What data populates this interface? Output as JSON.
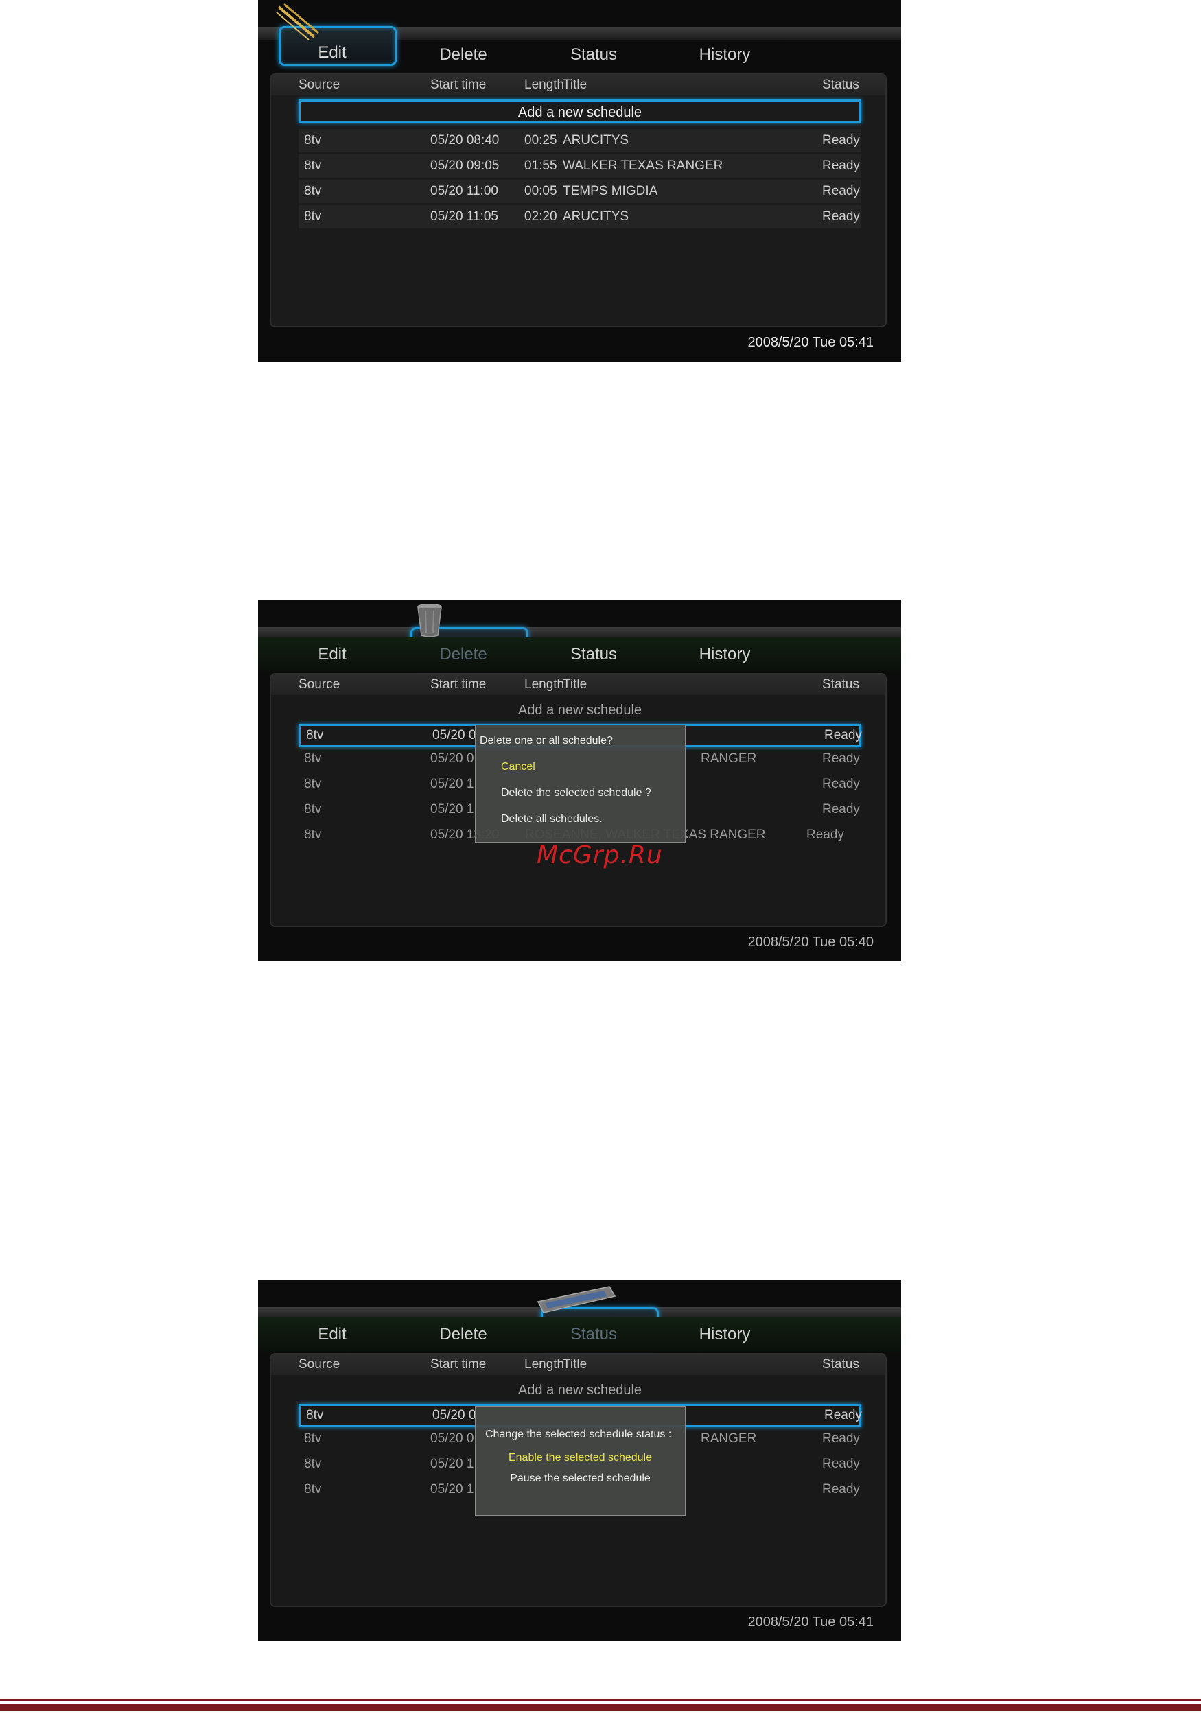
{
  "tabs": {
    "edit": "Edit",
    "delete": "Delete",
    "status": "Status",
    "history": "History"
  },
  "columns": {
    "source": "Source",
    "start": "Start time",
    "length": "Length",
    "title": "Title",
    "status": "Status"
  },
  "add_new": "Add a new schedule",
  "screen1": {
    "rows": [
      {
        "src": "8tv",
        "start": "05/20 08:40",
        "len": "00:25",
        "title": "ARUCITYS",
        "status": "Ready"
      },
      {
        "src": "8tv",
        "start": "05/20 09:05",
        "len": "01:55",
        "title": "WALKER TEXAS RANGER",
        "status": "Ready"
      },
      {
        "src": "8tv",
        "start": "05/20 11:00",
        "len": "00:05",
        "title": "TEMPS MIGDIA",
        "status": "Ready"
      },
      {
        "src": "8tv",
        "start": "05/20 11:05",
        "len": "02:20",
        "title": "ARUCITYS",
        "status": "Ready"
      }
    ],
    "datetime": "2008/5/20 Tue 05:41"
  },
  "screen2": {
    "rows": [
      {
        "src": "8tv",
        "start": "05/20 0",
        "status": "Ready"
      },
      {
        "src": "8tv",
        "start": "05/20 0",
        "title": "RANGER",
        "status": "Ready"
      },
      {
        "src": "8tv",
        "start": "05/20 1",
        "status": "Ready"
      },
      {
        "src": "8tv",
        "start": "05/20 1",
        "status": "Ready"
      },
      {
        "src": "8tv",
        "start": "05/20 13:20",
        "title": "ROSEANNE, WALKER TEXAS RANGER",
        "status": "Ready"
      }
    ],
    "dialog": {
      "title": "Delete one or all schedule?",
      "options": [
        "Cancel",
        "Delete the selected schedule ?",
        "Delete all schedules."
      ]
    },
    "datetime": "2008/5/20 Tue 05:40"
  },
  "screen3": {
    "rows": [
      {
        "src": "8tv",
        "start": "05/20 0",
        "status": "Ready"
      },
      {
        "src": "8tv",
        "start": "05/20 0",
        "title": "RANGER",
        "status": "Ready"
      },
      {
        "src": "8tv",
        "start": "05/20 1",
        "status": "Ready"
      },
      {
        "src": "8tv",
        "start": "05/20 1",
        "status": "Ready"
      }
    ],
    "dialog": {
      "title": "Change the selected schedule status :",
      "options": [
        "Enable the selected schedule",
        "Pause the selected schedule"
      ]
    },
    "datetime": "2008/5/20 Tue 05:41"
  },
  "watermark": "McGrp.Ru",
  "icons": {
    "edit": "pencil-icon",
    "delete": "trash-can-icon",
    "status": "status-bar-icon"
  },
  "colors": {
    "accent": "#1e9ad8",
    "highlight": "#e8e04a",
    "watermark": "#d02024"
  }
}
